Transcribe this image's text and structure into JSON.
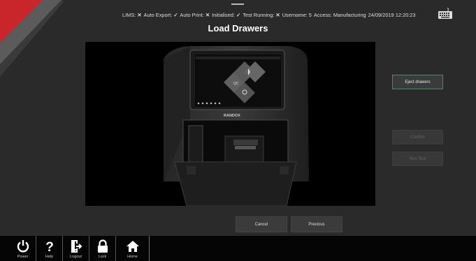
{
  "status": {
    "lims_label": "LIMS:",
    "lims_state": "✕",
    "auto_export_label": "Auto Export:",
    "auto_export_state": "✓",
    "auto_print_label": "Auto Print:",
    "auto_print_state": "✕",
    "initialised_label": "Initialised:",
    "initialised_state": "✓",
    "test_running_label": "Test Running:",
    "test_running_state": "✕",
    "username": "Username: 5",
    "access": "Access: Manufacturing",
    "datetime": "24/09/2019 12:20:23"
  },
  "title": "Load Drawers",
  "device": {
    "brand": "RANDOX",
    "menu_labels": [
      "QC"
    ]
  },
  "side_buttons": {
    "eject": "Eject drawers",
    "confirm": "Confirm",
    "run_test": "Run Test"
  },
  "actions": {
    "cancel": "Cancel",
    "previous": "Previous"
  },
  "nav": {
    "power": "Power",
    "help": "Help",
    "logout": "Logout",
    "lock": "Lock",
    "home": "Home"
  },
  "colors": {
    "accent_red": "#c8262b",
    "accent_green": "#4a8a6c",
    "background": "#2a2a2a"
  },
  "icons": [
    "keyboard-icon",
    "power-icon",
    "help-icon",
    "logout-icon",
    "lock-icon",
    "home-icon"
  ]
}
